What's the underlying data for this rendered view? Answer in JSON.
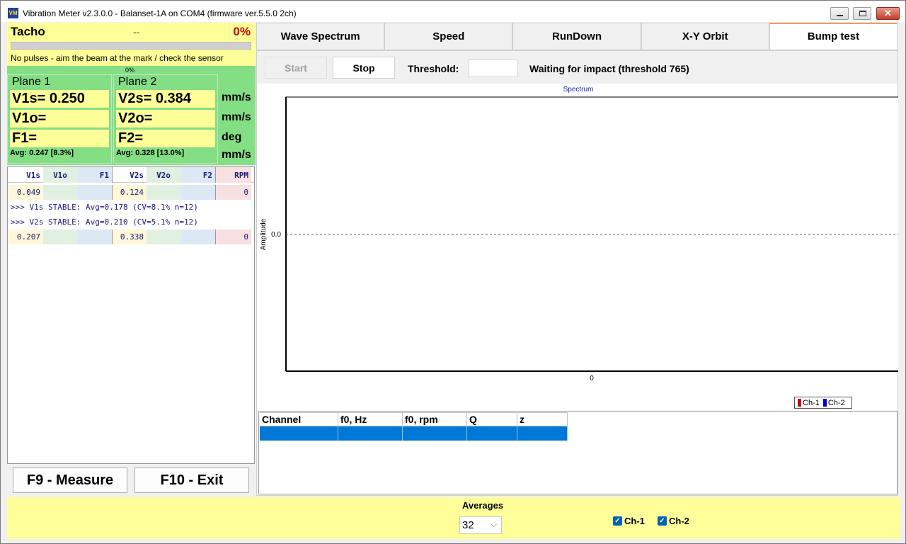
{
  "window": {
    "title": "Vibration Meter v2.3.0.0 - Balanset-1A on COM4 (firmware ver.5.5.0 2ch)",
    "icon_text": "VM"
  },
  "tacho": {
    "label": "Tacho",
    "rpm": "--",
    "percent": "0%",
    "progress": 0.0,
    "message": "No pulses - aim the beam at the mark / check the sensor",
    "bar_percent": "0%"
  },
  "planes": {
    "plane1": {
      "title": "Plane 1",
      "v_s": "V1s= 0.250",
      "v_o": "V1o=",
      "f": "F1=",
      "avg": "Avg: 0.247 [8.3%]"
    },
    "plane2": {
      "title": "Plane 2",
      "v_s": "V2s= 0.384",
      "v_o": "V2o=",
      "f": "F2=",
      "avg": "Avg: 0.328 [13.0%]"
    },
    "units": [
      "mm/s",
      "mm/s",
      "deg",
      "mm/s"
    ]
  },
  "readings": {
    "headers": [
      "V1s",
      "V1o",
      "F1",
      "V2s",
      "V2o",
      "F2",
      "RPM"
    ],
    "row1": [
      "0.049",
      "",
      "",
      "0.124",
      "",
      "",
      "0"
    ],
    "msg1": ">>> V1s STABLE: Avg=0.178 (CV=8.1% n=12)",
    "msg2": ">>> V2s STABLE: Avg=0.210 (CV=5.1% n=12)",
    "row2": [
      "0.207",
      "",
      "",
      "0.338",
      "",
      "",
      "0"
    ]
  },
  "buttons": {
    "measure": "F9 - Measure",
    "exit": "F10 - Exit"
  },
  "tabs": [
    "Wave Spectrum",
    "Speed",
    "RunDown",
    "X-Y Orbit",
    "Bump test"
  ],
  "toolbar": {
    "start": "Start",
    "stop": "Stop",
    "threshold_label": "Threshold:",
    "threshold_value": "",
    "status": "Waiting for impact (threshold 765)"
  },
  "chart_data": {
    "type": "line",
    "title": "Spectrum",
    "xlabel": "",
    "ylabel": "Amplitude",
    "x_ticks": [
      "0"
    ],
    "y_ticks": [
      "0.0"
    ],
    "series": [
      {
        "name": "Ch-1",
        "color": "#cc0000",
        "values": []
      },
      {
        "name": "Ch-2",
        "color": "#0000cc",
        "values": []
      }
    ],
    "grid": false,
    "legend": "bottom-right"
  },
  "legend": {
    "ch1": "Ch-1",
    "ch2": "Ch-2",
    "ch1_color": "#cc0000",
    "ch2_color": "#0000cc"
  },
  "results": {
    "headers": [
      "Channel",
      "f0, Hz",
      "f0, rpm",
      "Q",
      "z"
    ],
    "selected_row": [
      "",
      "",
      "",
      "",
      ""
    ]
  },
  "bottom": {
    "averages_label": "Averages",
    "averages_value": "32",
    "ch1_label": "Ch-1",
    "ch2_label": "Ch-2",
    "ch1_checked": true,
    "ch2_checked": true
  }
}
